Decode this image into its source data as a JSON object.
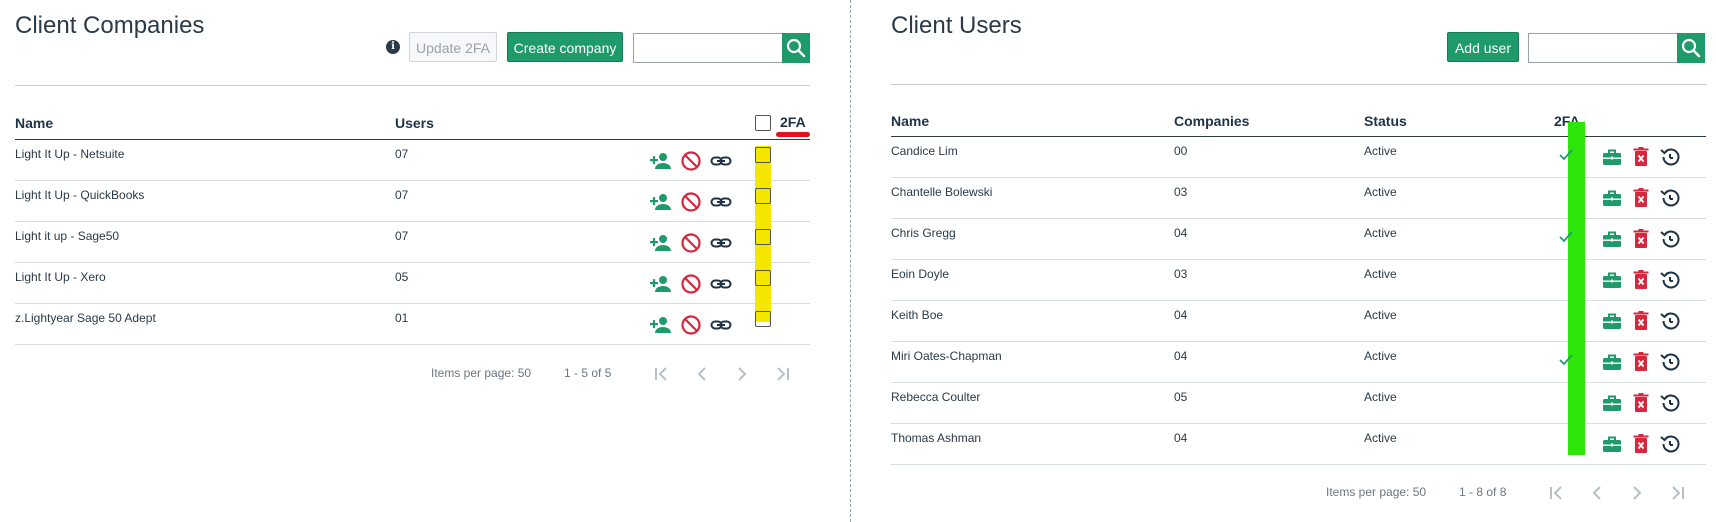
{
  "companies": {
    "title": "Client Companies",
    "update2fa_label": "Update 2FA",
    "create_label": "Create company",
    "search": {
      "placeholder": "",
      "value": ""
    },
    "headers": {
      "name": "Name",
      "users": "Users",
      "twofa": "2FA"
    },
    "rows": [
      {
        "name": "Light It Up - Netsuite",
        "users": "07"
      },
      {
        "name": "Light It Up - QuickBooks",
        "users": "07"
      },
      {
        "name": "Light it up - Sage50",
        "users": "07"
      },
      {
        "name": "Light It Up - Xero",
        "users": "05"
      },
      {
        "name": "z.Lightyear Sage 50 Adept",
        "users": "01"
      }
    ],
    "pager": {
      "items_per_page": "Items per page: 50",
      "range": "1 - 5 of 5"
    }
  },
  "users": {
    "title": "Client Users",
    "add_label": "Add user",
    "search": {
      "placeholder": "",
      "value": ""
    },
    "headers": {
      "name": "Name",
      "companies": "Companies",
      "status": "Status",
      "twofa": "2FA"
    },
    "rows": [
      {
        "name": "Candice Lim",
        "companies": "00",
        "status": "Active",
        "twofa": true
      },
      {
        "name": "Chantelle Bolewski",
        "companies": "03",
        "status": "Active",
        "twofa": false
      },
      {
        "name": "Chris Gregg",
        "companies": "04",
        "status": "Active",
        "twofa": true
      },
      {
        "name": "Eoin Doyle",
        "companies": "03",
        "status": "Active",
        "twofa": false
      },
      {
        "name": "Keith Boe",
        "companies": "04",
        "status": "Active",
        "twofa": false
      },
      {
        "name": "Miri Oates-Chapman",
        "companies": "04",
        "status": "Active",
        "twofa": true
      },
      {
        "name": "Rebecca Coulter",
        "companies": "05",
        "status": "Active",
        "twofa": false
      },
      {
        "name": "Thomas Ashman",
        "companies": "04",
        "status": "Active",
        "twofa": false
      }
    ],
    "pager": {
      "items_per_page": "Items per page: 50",
      "range": "1 - 8 of 8"
    }
  },
  "colors": {
    "accent": "#1f9a6b",
    "danger": "#d7263d",
    "highlight_yellow": "#f5e600",
    "highlight_green": "#2ee60a",
    "underline_red": "#e0141e"
  }
}
